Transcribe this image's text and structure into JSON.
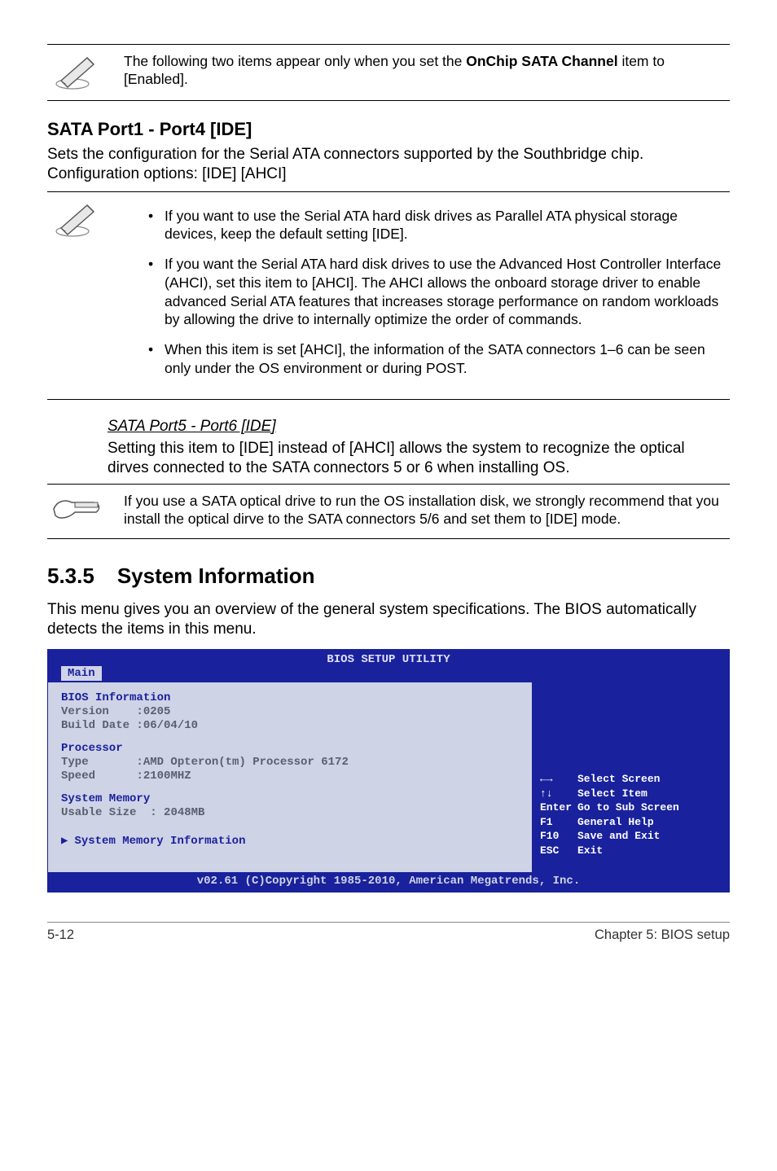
{
  "top_note": {
    "text_before": "The following two items appear only when you set the ",
    "bold": "OnChip SATA Channel",
    "text_after": " item to [Enabled]."
  },
  "sata14": {
    "heading": "SATA Port1 - Port4 [IDE]",
    "para": "Sets the configuration for the Serial ATA connectors supported by the Southbridge chip. Configuration options: [IDE] [AHCI]",
    "bullets": [
      "If you want to use the Serial ATA hard disk drives as Parallel ATA physical storage devices, keep the default setting [IDE].",
      "If you want the Serial ATA hard disk drives to use the Advanced Host Controller Interface (AHCI), set this item to [AHCI]. The AHCI allows the onboard storage driver to enable advanced Serial ATA features that increases storage performance on random workloads by allowing the drive to internally optimize the order of commands.",
      "When this item is set [AHCI], the information of the SATA connectors 1–6 can be seen only under the OS environment or during POST."
    ]
  },
  "sata56": {
    "heading": "SATA Port5 - Port6 [IDE]",
    "para": "Setting this item to [IDE] instead of [AHCI] allows the system to recognize the optical dirves connected to the SATA connectors 5 or 6 when installing OS."
  },
  "hand_note": "If you use a SATA optical drive to run the OS installation disk, we strongly recommend that you install the optical dirve to the SATA connectors 5/6 and set them to [IDE] mode.",
  "sec535": {
    "num": "5.3.5",
    "title": "System Information",
    "para": "This menu gives you an overview of the general system specifications. The BIOS automatically detects the items in this menu."
  },
  "bios": {
    "title": "BIOS SETUP UTILITY",
    "tab": "Main",
    "groups": {
      "bios_info": {
        "heading": "BIOS Information",
        "version_label": "Version",
        "version_value": ":0205",
        "build_label": "Build Date",
        "build_value": ":06/04/10"
      },
      "processor": {
        "heading": "Processor",
        "type_label": "Type",
        "type_value": ":AMD Opteron(tm) Processor 6172",
        "speed_label": "Speed",
        "speed_value": ":2100MHZ"
      },
      "memory": {
        "heading": "System Memory",
        "usable_label": "Usable Size",
        "usable_value": ": 2048MB"
      },
      "submenu": "System Memory Information"
    },
    "help": {
      "l1": {
        "k": "←→",
        "v": "Select Screen"
      },
      "l2": {
        "k": "↑↓",
        "v": "Select Item"
      },
      "l3": {
        "k": "Enter",
        "v": "Go to Sub Screen"
      },
      "l4": {
        "k": "F1",
        "v": "General Help"
      },
      "l5": {
        "k": "F10",
        "v": "Save and Exit"
      },
      "l6": {
        "k": "ESC",
        "v": "Exit"
      }
    },
    "footer": "v02.61 (C)Copyright 1985-2010, American Megatrends, Inc."
  },
  "footer": {
    "left": "5-12",
    "right": "Chapter 5: BIOS setup"
  }
}
